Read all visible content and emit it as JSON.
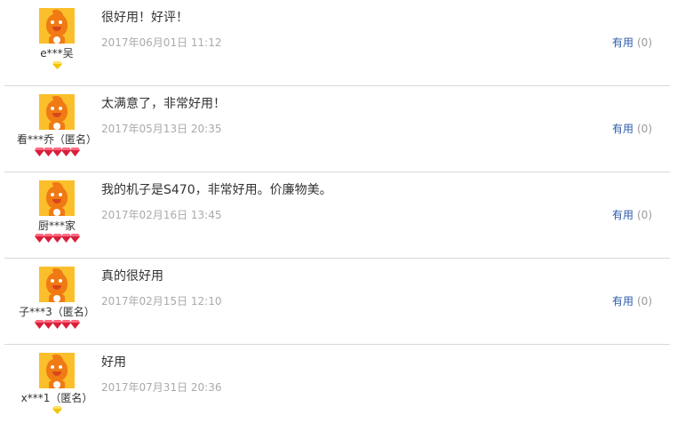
{
  "reviews": [
    {
      "user": "e***吴",
      "content": "很好用！好评！",
      "time": "2017年06月01日 11:12",
      "useful_label": "有用",
      "useful_count": "(0)",
      "badge": "yellow",
      "show_useful": true
    },
    {
      "user": "看***乔（匿名）",
      "content": "太满意了，非常好用！",
      "time": "2017年05月13日 20:35",
      "useful_label": "有用",
      "useful_count": "(0)",
      "badge": "red",
      "show_useful": true
    },
    {
      "user": "厨***家",
      "content": "我的机子是S470，非常好用。价廉物美。",
      "time": "2017年02月16日 13:45",
      "useful_label": "有用",
      "useful_count": "(0)",
      "badge": "red",
      "show_useful": true
    },
    {
      "user": "子***3（匿名）",
      "content": "真的很好用",
      "time": "2017年02月15日 12:10",
      "useful_label": "有用",
      "useful_count": "(0)",
      "badge": "red",
      "show_useful": true
    },
    {
      "user": "x***1（匿名）",
      "content": "好用",
      "time": "2017年07月31日 20:36",
      "useful_label": "",
      "useful_count": "",
      "badge": "yellow",
      "show_useful": false
    }
  ]
}
